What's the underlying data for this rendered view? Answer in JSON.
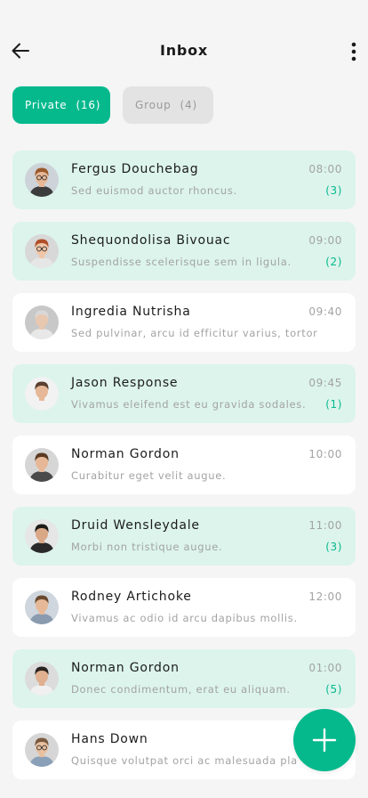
{
  "header": {
    "title": "Inbox",
    "back_icon": "arrow-left-icon",
    "more_icon": "more-vertical-icon"
  },
  "tabs": [
    {
      "label": "Private",
      "count": "(16)",
      "active": true
    },
    {
      "label": "Group",
      "count": "(4)",
      "active": false
    }
  ],
  "colors": {
    "accent": "#05b98d",
    "unread_bg": "#dcf4ec",
    "read_bg": "#ffffff",
    "page_bg": "#f5f5f5"
  },
  "messages": [
    {
      "name": "Fergus Douchebag",
      "time": "08:00",
      "preview": "Sed euismod auctor rhoncus.",
      "badge": "(3)",
      "unread": true,
      "avatar": {
        "hair": "#9a5a2c",
        "skin": "#e8b896",
        "shirt": "#3c3c3c",
        "bg": "#cdd3d8",
        "glasses": true
      }
    },
    {
      "name": "Shequondolisa Bivouac",
      "time": "09:00",
      "preview": "Suspendisse scelerisque sem in ligula.",
      "badge": "(2)",
      "unread": true,
      "avatar": {
        "hair": "#b0502a",
        "skin": "#f0c6a8",
        "shirt": "#e6e6e6",
        "bg": "#d8d8d8",
        "glasses": true
      }
    },
    {
      "name": "Ingredia Nutrisha",
      "time": "09:40",
      "preview": "Sed pulvinar, arcu id efficitur varius, tortor",
      "badge": "",
      "unread": false,
      "avatar": {
        "hair": "#d8d8d8",
        "skin": "#e8c8b0",
        "shirt": "#e8e8e8",
        "bg": "#c8c8c8",
        "glasses": false
      }
    },
    {
      "name": "Jason Response",
      "time": "09:45",
      "preview": "Vivamus eleifend est eu gravida sodales.",
      "badge": "(1)",
      "unread": true,
      "avatar": {
        "hair": "#5a4030",
        "skin": "#e6b898",
        "shirt": "#f2f2f2",
        "bg": "#f2f2f2",
        "glasses": false
      }
    },
    {
      "name": "Norman Gordon",
      "time": "10:00",
      "preview": "Curabitur eget velit augue.",
      "badge": "",
      "unread": false,
      "avatar": {
        "hair": "#5a3a22",
        "skin": "#e6b898",
        "shirt": "#4a4a4a",
        "bg": "#d6d6d6",
        "glasses": false
      }
    },
    {
      "name": "Druid Wensleydale",
      "time": "11:00",
      "preview": "Morbi non tristique augue.",
      "badge": "(3)",
      "unread": true,
      "avatar": {
        "hair": "#1e1a18",
        "skin": "#d9a887",
        "shirt": "#2a2a2a",
        "bg": "#e6e6e6",
        "glasses": false
      }
    },
    {
      "name": "Rodney Artichoke",
      "time": "12:00",
      "preview": "Vivamus ac odio id arcu dapibus mollis.",
      "badge": "",
      "unread": false,
      "avatar": {
        "hair": "#6a4a30",
        "skin": "#e6b898",
        "shirt": "#8a9bb0",
        "bg": "#cfd6dd",
        "glasses": false
      }
    },
    {
      "name": "Norman Gordon",
      "time": "01:00",
      "preview": "Donec condimentum, erat eu aliquam.",
      "badge": "(5)",
      "unread": true,
      "avatar": {
        "hair": "#2a2420",
        "skin": "#e0b090",
        "shirt": "#f0f0f0",
        "bg": "#dcdcdc",
        "glasses": false
      }
    },
    {
      "name": "Hans Down",
      "time": "",
      "preview": "Quisque volutpat orci ac malesuada pla",
      "badge": "",
      "unread": false,
      "avatar": {
        "hair": "#7a5a40",
        "skin": "#e8c0a0",
        "shirt": "#8aa0b8",
        "bg": "#d6d6d6",
        "glasses": true
      }
    }
  ],
  "fab": {
    "icon": "plus-icon"
  }
}
